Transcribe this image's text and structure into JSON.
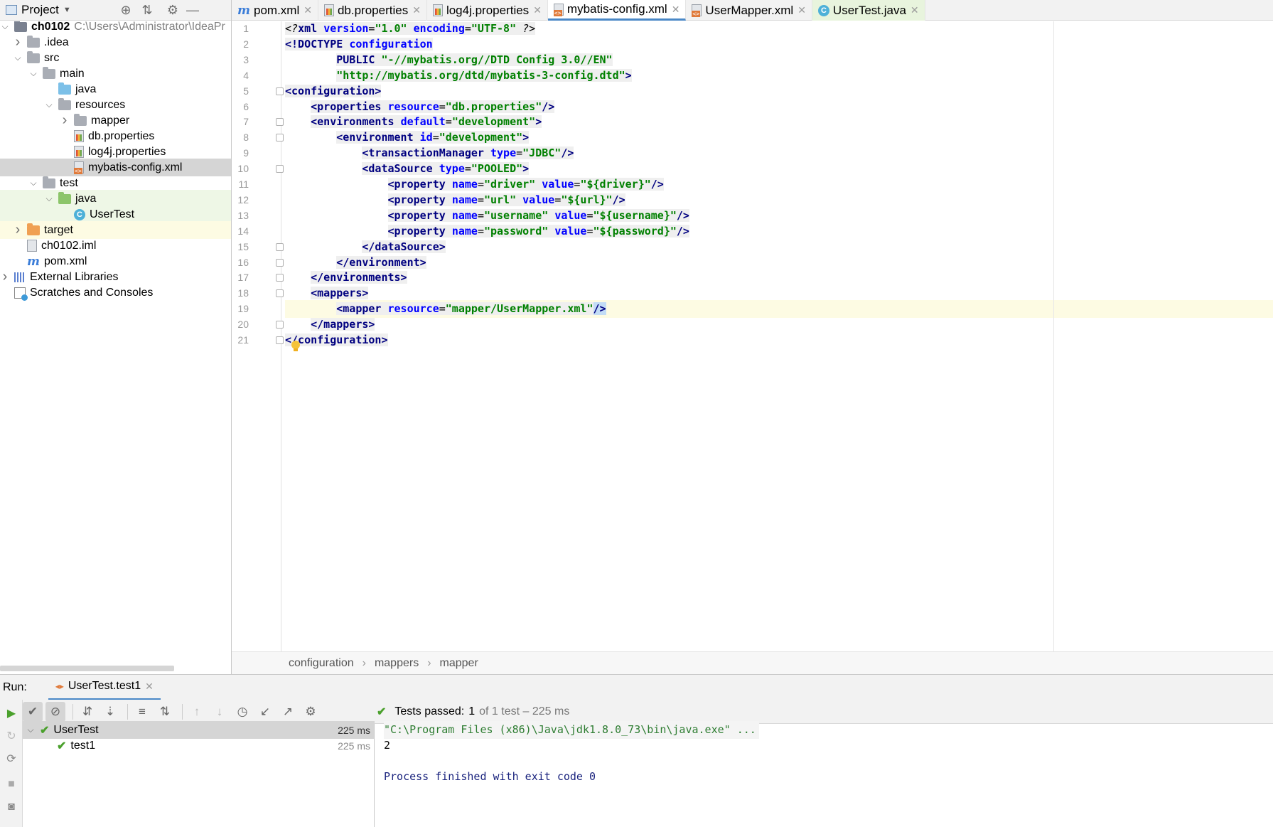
{
  "project_pane": {
    "title": "Project",
    "tree": [
      {
        "label": "ch0102",
        "extra": "C:\\Users\\Administrator\\IdeaPr",
        "depth": 0,
        "arrow": "down",
        "icon": "module-folder-icon",
        "bold": true
      },
      {
        "label": ".idea",
        "depth": 1,
        "arrow": "right",
        "icon": "folder-icon"
      },
      {
        "label": "src",
        "depth": 1,
        "arrow": "down",
        "icon": "folder-icon"
      },
      {
        "label": "main",
        "depth": 2,
        "arrow": "down",
        "icon": "folder-icon"
      },
      {
        "label": "java",
        "depth": 3,
        "arrow": "",
        "icon": "source-folder-icon"
      },
      {
        "label": "resources",
        "depth": 3,
        "arrow": "down",
        "icon": "resources-folder-icon"
      },
      {
        "label": "mapper",
        "depth": 4,
        "arrow": "right",
        "icon": "folder-icon"
      },
      {
        "label": "db.properties",
        "depth": 4,
        "arrow": "",
        "icon": "properties-file-icon"
      },
      {
        "label": "log4j.properties",
        "depth": 4,
        "arrow": "",
        "icon": "properties-file-icon"
      },
      {
        "label": "mybatis-config.xml",
        "depth": 4,
        "arrow": "",
        "icon": "xml-file-icon",
        "selected": true
      },
      {
        "label": "test",
        "depth": 2,
        "arrow": "down",
        "icon": "folder-icon"
      },
      {
        "label": "java",
        "depth": 3,
        "arrow": "down",
        "icon": "test-folder-icon",
        "bg": "test"
      },
      {
        "label": "UserTest",
        "depth": 4,
        "arrow": "",
        "icon": "class-icon",
        "bg": "test"
      },
      {
        "label": "target",
        "depth": 1,
        "arrow": "right",
        "icon": "excluded-folder-icon",
        "bg": "target"
      },
      {
        "label": "ch0102.iml",
        "depth": 1,
        "arrow": "",
        "icon": "iml-file-icon"
      },
      {
        "label": "pom.xml",
        "depth": 1,
        "arrow": "",
        "icon": "maven-icon"
      },
      {
        "label": "External Libraries",
        "depth": 0,
        "arrow": "right",
        "icon": "libraries-icon"
      },
      {
        "label": "Scratches and Consoles",
        "depth": 0,
        "arrow": "",
        "icon": "scratches-icon"
      }
    ]
  },
  "tabs": [
    {
      "label": "pom.xml",
      "icon": "maven-icon"
    },
    {
      "label": "db.properties",
      "icon": "properties-file-icon"
    },
    {
      "label": "log4j.properties",
      "icon": "properties-file-icon"
    },
    {
      "label": "mybatis-config.xml",
      "icon": "xml-file-icon",
      "active": true
    },
    {
      "label": "UserMapper.xml",
      "icon": "xml-file-icon"
    },
    {
      "label": "UserTest.java",
      "icon": "class-icon",
      "green": true
    }
  ],
  "editor": {
    "lines": [
      {
        "n": "1",
        "fold": false,
        "t": [
          [
            "pi",
            "<?"
          ],
          [
            "tg",
            "xml "
          ],
          [
            "at",
            "version"
          ],
          [
            "pn",
            "="
          ],
          [
            "vl",
            "\"1.0\""
          ],
          [
            "pn",
            " "
          ],
          [
            "at",
            "encoding"
          ],
          [
            "pn",
            "="
          ],
          [
            "vl",
            "\"UTF-8\""
          ],
          [
            "pi",
            " ?>"
          ]
        ]
      },
      {
        "n": "2",
        "fold": false,
        "t": [
          [
            "tg",
            "<!DOCTYPE "
          ],
          [
            "at",
            "configuration"
          ]
        ]
      },
      {
        "n": "3",
        "fold": false,
        "t": [
          [
            "pn",
            "        "
          ],
          [
            "tg",
            "PUBLIC "
          ],
          [
            "vl",
            "\"-//mybatis.org//DTD Config 3.0//EN\""
          ]
        ]
      },
      {
        "n": "4",
        "fold": false,
        "t": [
          [
            "pn",
            "        "
          ],
          [
            "vl",
            "\"http://mybatis.org/dtd/mybatis-3-config.dtd\""
          ],
          [
            "tg",
            ">"
          ]
        ]
      },
      {
        "n": "5",
        "fold": true,
        "t": [
          [
            "tg",
            "<configuration>"
          ]
        ]
      },
      {
        "n": "6",
        "fold": false,
        "t": [
          [
            "pn",
            "    "
          ],
          [
            "tg",
            "<properties "
          ],
          [
            "at",
            "resource"
          ],
          [
            "pn",
            "="
          ],
          [
            "vl",
            "\"db.properties\""
          ],
          [
            "tg",
            "/>"
          ]
        ]
      },
      {
        "n": "7",
        "fold": true,
        "t": [
          [
            "pn",
            "    "
          ],
          [
            "tg",
            "<environments "
          ],
          [
            "at",
            "default"
          ],
          [
            "pn",
            "="
          ],
          [
            "vl",
            "\"development\""
          ],
          [
            "tg",
            ">"
          ]
        ]
      },
      {
        "n": "8",
        "fold": true,
        "t": [
          [
            "pn",
            "        "
          ],
          [
            "tg",
            "<environment "
          ],
          [
            "at",
            "id"
          ],
          [
            "pn",
            "="
          ],
          [
            "vl",
            "\"development\""
          ],
          [
            "tg",
            ">"
          ]
        ]
      },
      {
        "n": "9",
        "fold": false,
        "t": [
          [
            "pn",
            "            "
          ],
          [
            "tg",
            "<transactionManager "
          ],
          [
            "at",
            "type"
          ],
          [
            "pn",
            "="
          ],
          [
            "vl",
            "\"JDBC\""
          ],
          [
            "tg",
            "/>"
          ]
        ]
      },
      {
        "n": "10",
        "fold": true,
        "t": [
          [
            "pn",
            "            "
          ],
          [
            "tg",
            "<dataSource "
          ],
          [
            "at",
            "type"
          ],
          [
            "pn",
            "="
          ],
          [
            "vl",
            "\"POOLED\""
          ],
          [
            "tg",
            ">"
          ]
        ]
      },
      {
        "n": "11",
        "fold": false,
        "t": [
          [
            "pn",
            "                "
          ],
          [
            "tg",
            "<property "
          ],
          [
            "at",
            "name"
          ],
          [
            "pn",
            "="
          ],
          [
            "vl",
            "\"driver\""
          ],
          [
            "pn",
            " "
          ],
          [
            "at",
            "value"
          ],
          [
            "pn",
            "="
          ],
          [
            "vl",
            "\"${driver}\""
          ],
          [
            "tg",
            "/>"
          ]
        ]
      },
      {
        "n": "12",
        "fold": false,
        "t": [
          [
            "pn",
            "                "
          ],
          [
            "tg",
            "<property "
          ],
          [
            "at",
            "name"
          ],
          [
            "pn",
            "="
          ],
          [
            "vl",
            "\"url\""
          ],
          [
            "pn",
            " "
          ],
          [
            "at",
            "value"
          ],
          [
            "pn",
            "="
          ],
          [
            "vl",
            "\"${url}\""
          ],
          [
            "tg",
            "/>"
          ]
        ]
      },
      {
        "n": "13",
        "fold": false,
        "t": [
          [
            "pn",
            "                "
          ],
          [
            "tg",
            "<property "
          ],
          [
            "at",
            "name"
          ],
          [
            "pn",
            "="
          ],
          [
            "vl",
            "\"username\""
          ],
          [
            "pn",
            " "
          ],
          [
            "at",
            "value"
          ],
          [
            "pn",
            "="
          ],
          [
            "vl",
            "\"${username}\""
          ],
          [
            "tg",
            "/>"
          ]
        ]
      },
      {
        "n": "14",
        "fold": false,
        "t": [
          [
            "pn",
            "                "
          ],
          [
            "tg",
            "<property "
          ],
          [
            "at",
            "name"
          ],
          [
            "pn",
            "="
          ],
          [
            "vl",
            "\"password\""
          ],
          [
            "pn",
            " "
          ],
          [
            "at",
            "value"
          ],
          [
            "pn",
            "="
          ],
          [
            "vl",
            "\"${password}\""
          ],
          [
            "tg",
            "/>"
          ]
        ]
      },
      {
        "n": "15",
        "fold": true,
        "t": [
          [
            "pn",
            "            "
          ],
          [
            "tg",
            "</dataSource>"
          ]
        ]
      },
      {
        "n": "16",
        "fold": true,
        "t": [
          [
            "pn",
            "        "
          ],
          [
            "tg",
            "</environment>"
          ]
        ]
      },
      {
        "n": "17",
        "fold": true,
        "t": [
          [
            "pn",
            "    "
          ],
          [
            "tg",
            "</environments>"
          ]
        ]
      },
      {
        "n": "18",
        "fold": true,
        "t": [
          [
            "pn",
            "    "
          ],
          [
            "tg",
            "<mappers>"
          ]
        ]
      },
      {
        "n": "19",
        "fold": false,
        "current": true,
        "t": [
          [
            "pn",
            "        "
          ],
          [
            "tg",
            "<mapper "
          ],
          [
            "at",
            "resource"
          ],
          [
            "pn",
            "="
          ],
          [
            "vl",
            "\"mapper/UserMapper.xml\""
          ],
          [
            "tgsq",
            "/>"
          ]
        ]
      },
      {
        "n": "20",
        "fold": true,
        "t": [
          [
            "pn",
            "    "
          ],
          [
            "tg",
            "</mappers>"
          ]
        ]
      },
      {
        "n": "21",
        "fold": true,
        "t": [
          [
            "tg",
            "</configuration>"
          ]
        ]
      }
    ]
  },
  "breadcrumbs": [
    "configuration",
    "mappers",
    "mapper"
  ],
  "run": {
    "label": "Run:",
    "tab_label": "UserTest.test1",
    "status_prefix": "Tests passed:",
    "status_count": "1",
    "status_suffix": "of 1 test – 225 ms",
    "tests": [
      {
        "name": "UserTest",
        "time": "225 ms",
        "selected": true,
        "depth": 0
      },
      {
        "name": "test1",
        "time": "225 ms",
        "selected": false,
        "depth": 1
      }
    ],
    "console": [
      {
        "text": "\"C:\\Program Files (x86)\\Java\\jdk1.8.0_73\\bin\\java.exe\" ...",
        "kind": "cmd"
      },
      {
        "text": "2",
        "kind": "plain"
      },
      {
        "text": "",
        "kind": "plain"
      },
      {
        "text": "Process finished with exit code 0",
        "kind": "exit"
      }
    ]
  },
  "colors": {
    "accent": "#4a88c7",
    "pass": "#4aa02c",
    "tag": "#000080",
    "attr": "#0000ff",
    "value": "#008000"
  }
}
